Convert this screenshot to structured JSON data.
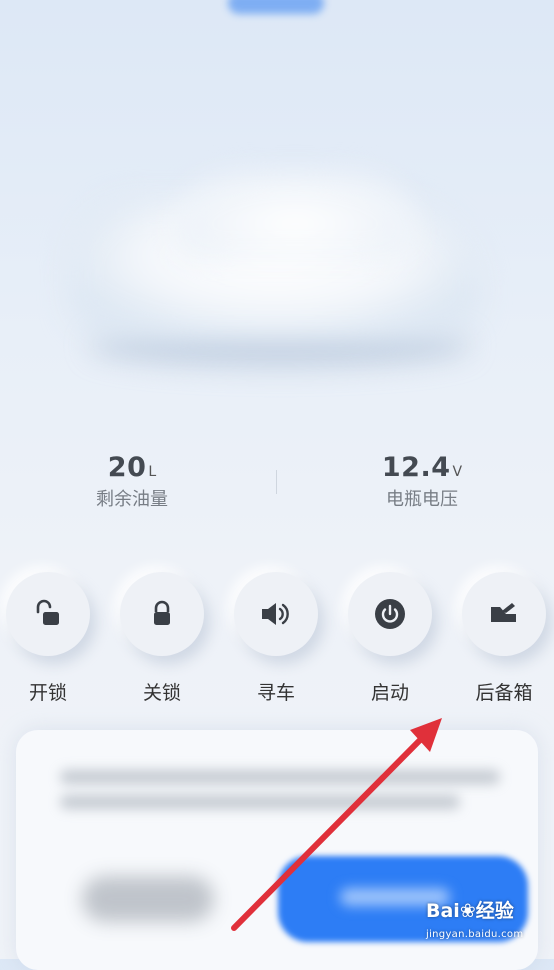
{
  "stats": {
    "fuel": {
      "value": "20",
      "unit": "L",
      "label": "剩余油量"
    },
    "battery": {
      "value": "12.4",
      "unit": "V",
      "label": "电瓶电压"
    }
  },
  "controls": [
    {
      "label": "开锁",
      "icon": "unlock-icon"
    },
    {
      "label": "关锁",
      "icon": "lock-icon"
    },
    {
      "label": "寻车",
      "icon": "speaker-icon"
    },
    {
      "label": "启动",
      "icon": "power-icon"
    },
    {
      "label": "后备箱",
      "icon": "trunk-icon"
    }
  ],
  "annotation": {
    "arrow_color": "#e0303a"
  },
  "watermark": {
    "brand": "Bai",
    "brand_suffix": "经验",
    "url": "jingyan.baidu.com"
  },
  "colors": {
    "primary": "#2d7df5",
    "icon": "#3a3f46"
  }
}
